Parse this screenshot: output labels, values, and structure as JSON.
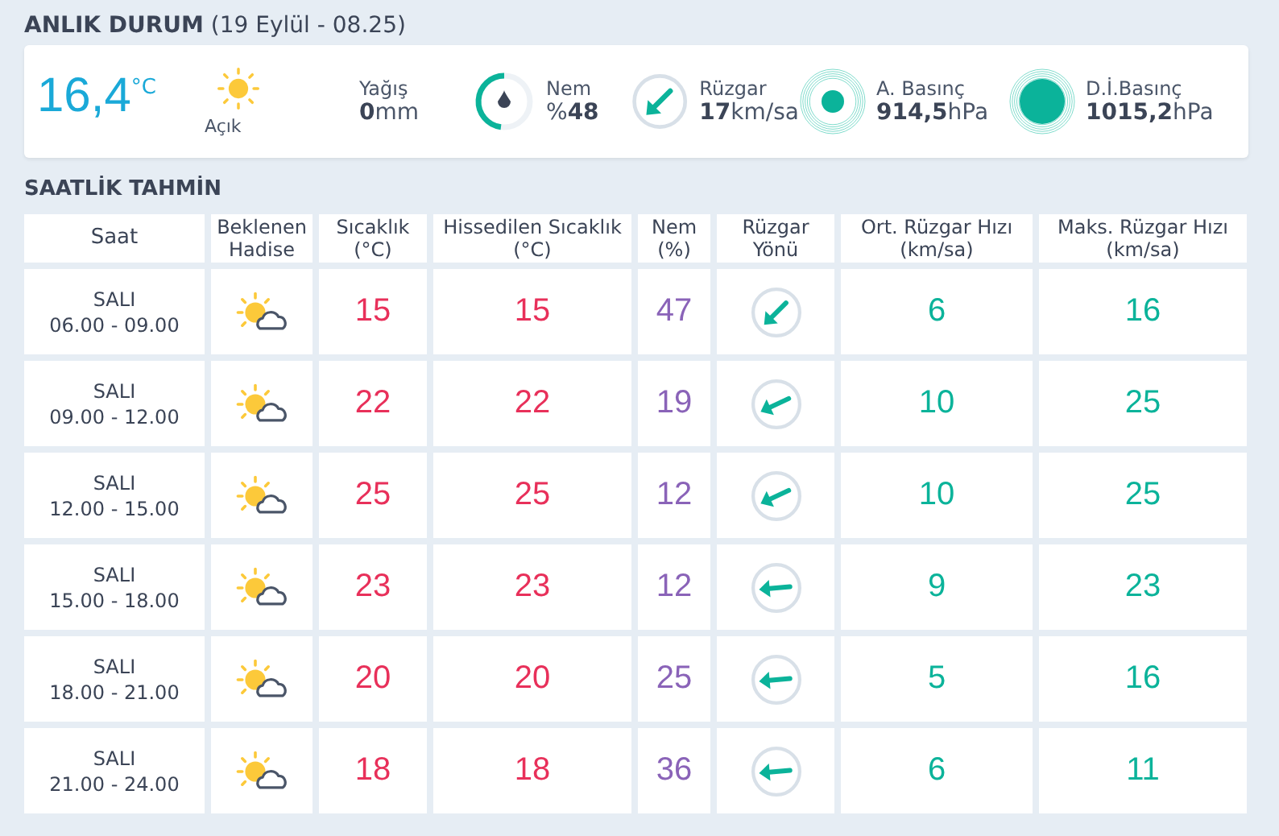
{
  "current": {
    "heading": "ANLIK DURUM",
    "date": "(19 Eylül - 08.25)",
    "temperature": "16,4",
    "unit": "°C",
    "condition": "Açık",
    "rain_label": "Yağış",
    "rain_value": "0",
    "rain_unit": "mm",
    "humidity_label": "Nem",
    "humidity_prefix": "%",
    "humidity_value": "48",
    "humidity_gauge": {
      "level": 0.48
    },
    "wind_label": "Rüzgar",
    "wind_value": "17",
    "wind_unit": "km/sa",
    "pressure_label": "A. Basınç",
    "pressure_value": "914,5",
    "pressure_unit": "hPa",
    "sea_pressure_label": "D.İ.Basınç",
    "sea_pressure_value": "1015,2",
    "sea_pressure_unit": "hPa"
  },
  "forecast": {
    "heading": "SAATLİK TAHMİN",
    "columns": [
      [
        "Saat"
      ],
      [
        "Beklenen",
        "Hadise"
      ],
      [
        "Sıcaklık",
        "(°C)"
      ],
      [
        "Hissedilen Sıcaklık",
        "(°C)"
      ],
      [
        "Nem",
        "(%)"
      ],
      [
        "Rüzgar",
        "Yönü"
      ],
      [
        "Ort. Rüzgar Hızı",
        "(km/sa)"
      ],
      [
        "Maks. Rüzgar Hızı",
        "(km/sa)"
      ]
    ],
    "rows": [
      {
        "day": "SALI",
        "time": "06.00 - 09.00",
        "temp": "15",
        "feels": "15",
        "humidity": "47",
        "kind": "sw",
        "avg": "6",
        "max": "16"
      },
      {
        "day": "SALI",
        "time": "09.00 - 12.00",
        "temp": "22",
        "feels": "22",
        "humidity": "19",
        "kind": "wsw",
        "avg": "10",
        "max": "25"
      },
      {
        "day": "SALI",
        "time": "12.00 - 15.00",
        "temp": "25",
        "feels": "25",
        "humidity": "12",
        "kind": "wsw",
        "avg": "10",
        "max": "25"
      },
      {
        "day": "SALI",
        "time": "15.00 - 18.00",
        "temp": "23",
        "feels": "23",
        "humidity": "12",
        "kind": "w",
        "avg": "9",
        "max": "23"
      },
      {
        "day": "SALI",
        "time": "18.00 - 21.00",
        "temp": "20",
        "feels": "20",
        "humidity": "25",
        "kind": "w",
        "avg": "5",
        "max": "16"
      },
      {
        "day": "SALI",
        "time": "21.00 - 24.00",
        "temp": "18",
        "feels": "18",
        "humidity": "36",
        "kind": "w",
        "avg": "6",
        "max": "11"
      }
    ]
  }
}
